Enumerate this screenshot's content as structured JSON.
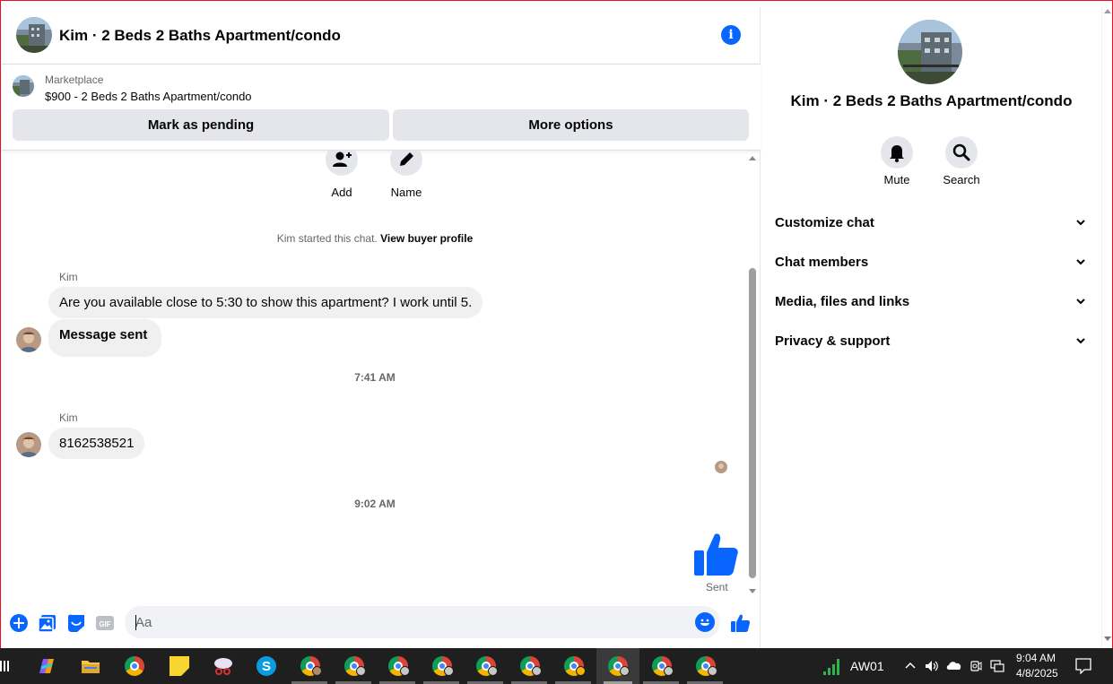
{
  "header": {
    "title": "Kim · 2 Beds 2 Baths Apartment/condo",
    "info_icon": "i"
  },
  "marketplace": {
    "label": "Marketplace",
    "listing": "$900 - 2 Beds 2 Baths Apartment/condo",
    "mark_pending_label": "Mark as pending",
    "more_options_label": "More options"
  },
  "chat_actions": {
    "add_label": "Add",
    "name_label": "Name"
  },
  "system": {
    "started": "Kim started this chat.",
    "view_profile": "View buyer profile"
  },
  "messages": [
    {
      "sender": "Kim",
      "text": "Are you available close to 5:30 to show this apartment? I work until 5."
    },
    {
      "text": "Message sent"
    },
    {
      "timestamp": "7:41 AM"
    },
    {
      "sender": "Kim",
      "text": "8162538521"
    },
    {
      "timestamp": "9:02 AM"
    },
    {
      "status": "Sent"
    }
  ],
  "composer": {
    "placeholder": "Aa",
    "gif_label": "GIF"
  },
  "info_panel": {
    "title": "Kim · 2 Beds 2 Baths Apartment/condo",
    "mute_label": "Mute",
    "search_label": "Search",
    "sections": [
      "Customize chat",
      "Chat members",
      "Media, files and links",
      "Privacy & support"
    ]
  },
  "taskbar": {
    "network_label": "AW01",
    "time": "9:04 AM",
    "date": "4/8/2025"
  },
  "colors": {
    "accent": "#0866ff",
    "bubble": "#f0f0f0",
    "taskbar": "#1f1f1f"
  }
}
